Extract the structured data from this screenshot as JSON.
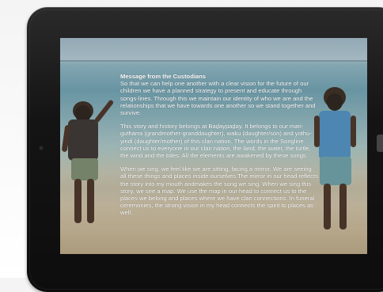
{
  "message": {
    "title": "Message from the Custodians",
    "paragraph1": "So that we can help one another with a clear vision for the future of our children we have a planned strategy to present and educate through songs-lines. Through this we maintain our identity of who we are and the relationships that we have towards one another so we stand together and survive.",
    "paragraph2": "This story and history belongs at Baḏaypaḏay. It belongs to our mari-gutharra (grandmother-granddaughter), waku (daughter/son) and yothu-yindi (daughter/mother) of this clan nation. The words in the Songline connect us to everyone in our clan nation, the land, the water, the turtle, the wind and the tides. All the elements are awakened by these songs.",
    "paragraph3": "When we sing, we feel like we are sitting, facing a mirror. We are seeing all these things and places inside ourselves.The mirror in our head reflects the story into my mouth andmakes the song we sing. When we sing this story, we see a map. We use the map in our head to connect us to the places we belong and places where we have clan connections. In funeral ceremonies, the strong vision in my head connects the spirit to places as well."
  },
  "colors": {
    "bezel": "#141414",
    "text": "#ffffff"
  }
}
